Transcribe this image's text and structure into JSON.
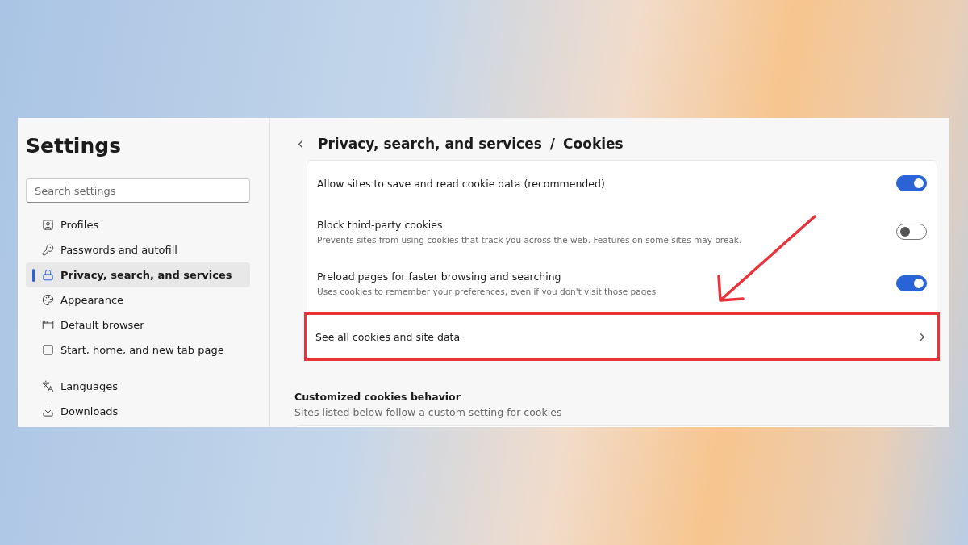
{
  "sidebar": {
    "title": "Settings",
    "search": {
      "placeholder": "Search settings"
    },
    "groups": [
      [
        {
          "label": "Profiles",
          "selected": false
        },
        {
          "label": "Passwords and autofill",
          "selected": false
        },
        {
          "label": "Privacy, search, and services",
          "selected": true
        },
        {
          "label": "Appearance",
          "selected": false
        },
        {
          "label": "Default browser",
          "selected": false
        },
        {
          "label": "Start, home, and new tab page",
          "selected": false
        }
      ],
      [
        {
          "label": "Languages",
          "selected": false
        },
        {
          "label": "Downloads",
          "selected": false
        }
      ]
    ]
  },
  "content": {
    "breadcrumb": [
      "Privacy, search, and services",
      "Cookies"
    ],
    "breadcrumb_separator": "/",
    "rows": [
      {
        "kind": "toggle",
        "label": "Allow sites to save and read cookie data (recommended)",
        "on": true,
        "highlighted": false
      },
      {
        "kind": "toggle",
        "label": "Block third-party cookies",
        "description": "Prevents sites from using cookies that track you across the web. Features on some sites may break.",
        "on": false,
        "highlighted": false
      },
      {
        "kind": "toggle",
        "label": "Preload pages for faster browsing and searching",
        "description": "Uses cookies to remember your preferences, even if you don't visit those pages",
        "on": true,
        "highlighted": false
      },
      {
        "kind": "link",
        "label": "See all cookies and site data",
        "highlighted": true
      }
    ],
    "section": {
      "title": "Customized cookies behavior",
      "subtitle": "Sites listed below follow a custom setting for cookies"
    }
  }
}
